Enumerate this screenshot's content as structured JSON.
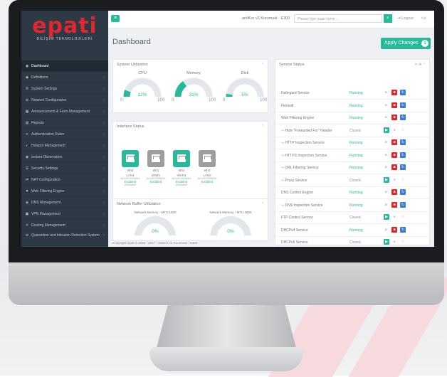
{
  "app": {
    "logo_text": "epati",
    "logo_sub": "BİLİŞİM TEKNOLOJİLERİ",
    "product": "antiKor v2 Kurumsal - E300",
    "search_placeholder": "Please type page name ...",
    "logout": "Logout",
    "page_title": "Dashboard",
    "apply_label": "Apply Changes",
    "apply_count": "1",
    "footer": "Copyright epati © 2016 - 2017 - antiKor v2 Kurumsal - E300"
  },
  "sidebar": {
    "items": [
      {
        "label": "Dashboard",
        "icon": "dashboard-icon",
        "glyph": "◉"
      },
      {
        "label": "Definitions",
        "icon": "tag-icon",
        "glyph": "◆"
      },
      {
        "label": "System Settings",
        "icon": "gears-icon",
        "glyph": "✲"
      },
      {
        "label": "Network Configuration",
        "icon": "globe-icon",
        "glyph": "⊕"
      },
      {
        "label": "Announcement & Form Management",
        "icon": "calendar-icon",
        "glyph": "▦"
      },
      {
        "label": "Reports",
        "icon": "report-icon",
        "glyph": "▤"
      },
      {
        "label": "Authentication Rules",
        "icon": "rules-icon",
        "glyph": "≡"
      },
      {
        "label": "Hotspot Management",
        "icon": "hotspot-icon",
        "glyph": "◐"
      },
      {
        "label": "Instant Observation",
        "icon": "eye-icon",
        "glyph": "◉"
      },
      {
        "label": "Security Settings",
        "icon": "shield-icon",
        "glyph": "⛨"
      },
      {
        "label": "NAT Configuration",
        "icon": "nat-icon",
        "glyph": "⇄"
      },
      {
        "label": "Web Filtering Engine",
        "icon": "filter-icon",
        "glyph": "▼"
      },
      {
        "label": "DNS Management",
        "icon": "dns-icon",
        "glyph": "◈"
      },
      {
        "label": "VPN Management",
        "icon": "vpn-icon",
        "glyph": "▣"
      },
      {
        "label": "Routing Management",
        "icon": "routing-icon",
        "glyph": "✕"
      },
      {
        "label": "Quarantine and Intrusion Detection System",
        "icon": "quarantine-icon",
        "glyph": "⊘"
      }
    ]
  },
  "system_utilization": {
    "title": "System Utilization",
    "gauges": [
      {
        "label": "CPU",
        "value": "12%",
        "fraction": 0.12,
        "min": "0",
        "max": "100"
      },
      {
        "label": "Memory",
        "value": "31%",
        "fraction": 0.31,
        "min": "0",
        "max": "100"
      },
      {
        "label": "Disk",
        "value": "5%",
        "fraction": 0.05,
        "min": "0",
        "max": "100"
      }
    ]
  },
  "interface_status": {
    "title": "Interface Status",
    "interfaces": [
      {
        "id": "eth0",
        "name": "LAN1",
        "meta": "10/100/1000Mb/s",
        "state": "Enabled",
        "speed": "1000baseT",
        "color": "#26b99a"
      },
      {
        "id": "eth1",
        "name": "DMZ1",
        "meta": "10/100/1000Mb/s",
        "state": "Enabled",
        "speed": "",
        "color": "#9e9e9e"
      },
      {
        "id": "eth2",
        "name": "WAN1",
        "meta": "10/100/1000Mb/s",
        "state": "Enabled",
        "speed": "1000baseT",
        "color": "#26b99a"
      },
      {
        "id": "eth3",
        "name": "LAN2",
        "meta": "10/100/1000Mb/s",
        "state": "Enabled",
        "speed": "",
        "color": "#9e9e9e"
      }
    ]
  },
  "network_buffer": {
    "title": "Network Buffer Utilization",
    "gauges": [
      {
        "label": "Network Memory - MTU 1500",
        "value": "0%"
      },
      {
        "label": "Network Memory - MTU 4000",
        "value": "0%"
      }
    ]
  },
  "service_status": {
    "title": "Service Status",
    "services": [
      {
        "name": "Haltegard Service",
        "status": "Running",
        "sub": false
      },
      {
        "name": "Firewall",
        "status": "Running",
        "sub": false
      },
      {
        "name": "Web Filtering Engine",
        "status": "Running",
        "sub": false
      },
      {
        "name": "Hide \"Forwarded For\" Header",
        "status": "Closed",
        "sub": true
      },
      {
        "name": "HTTP Inspection Service",
        "status": "Running",
        "sub": true
      },
      {
        "name": "HTTPS Inspection Service",
        "status": "Running",
        "sub": true
      },
      {
        "name": "URL Filtering Service",
        "status": "Running",
        "sub": true
      },
      {
        "name": "Proxy Service",
        "status": "Closed",
        "sub": true
      },
      {
        "name": "DNS Control Engine",
        "status": "Running",
        "sub": false
      },
      {
        "name": "DNS Inspection Service",
        "status": "Running",
        "sub": true
      },
      {
        "name": "FTP Control Service",
        "status": "Closed",
        "sub": false
      },
      {
        "name": "DHCPv4 Service",
        "status": "Running",
        "sub": false
      },
      {
        "name": "DHCPv6 Service",
        "status": "Closed",
        "sub": false
      }
    ]
  },
  "colors": {
    "accent": "#26b99a",
    "danger": "#e0262e",
    "info": "#3a7bd5",
    "sidebar": "#2d3a45"
  }
}
